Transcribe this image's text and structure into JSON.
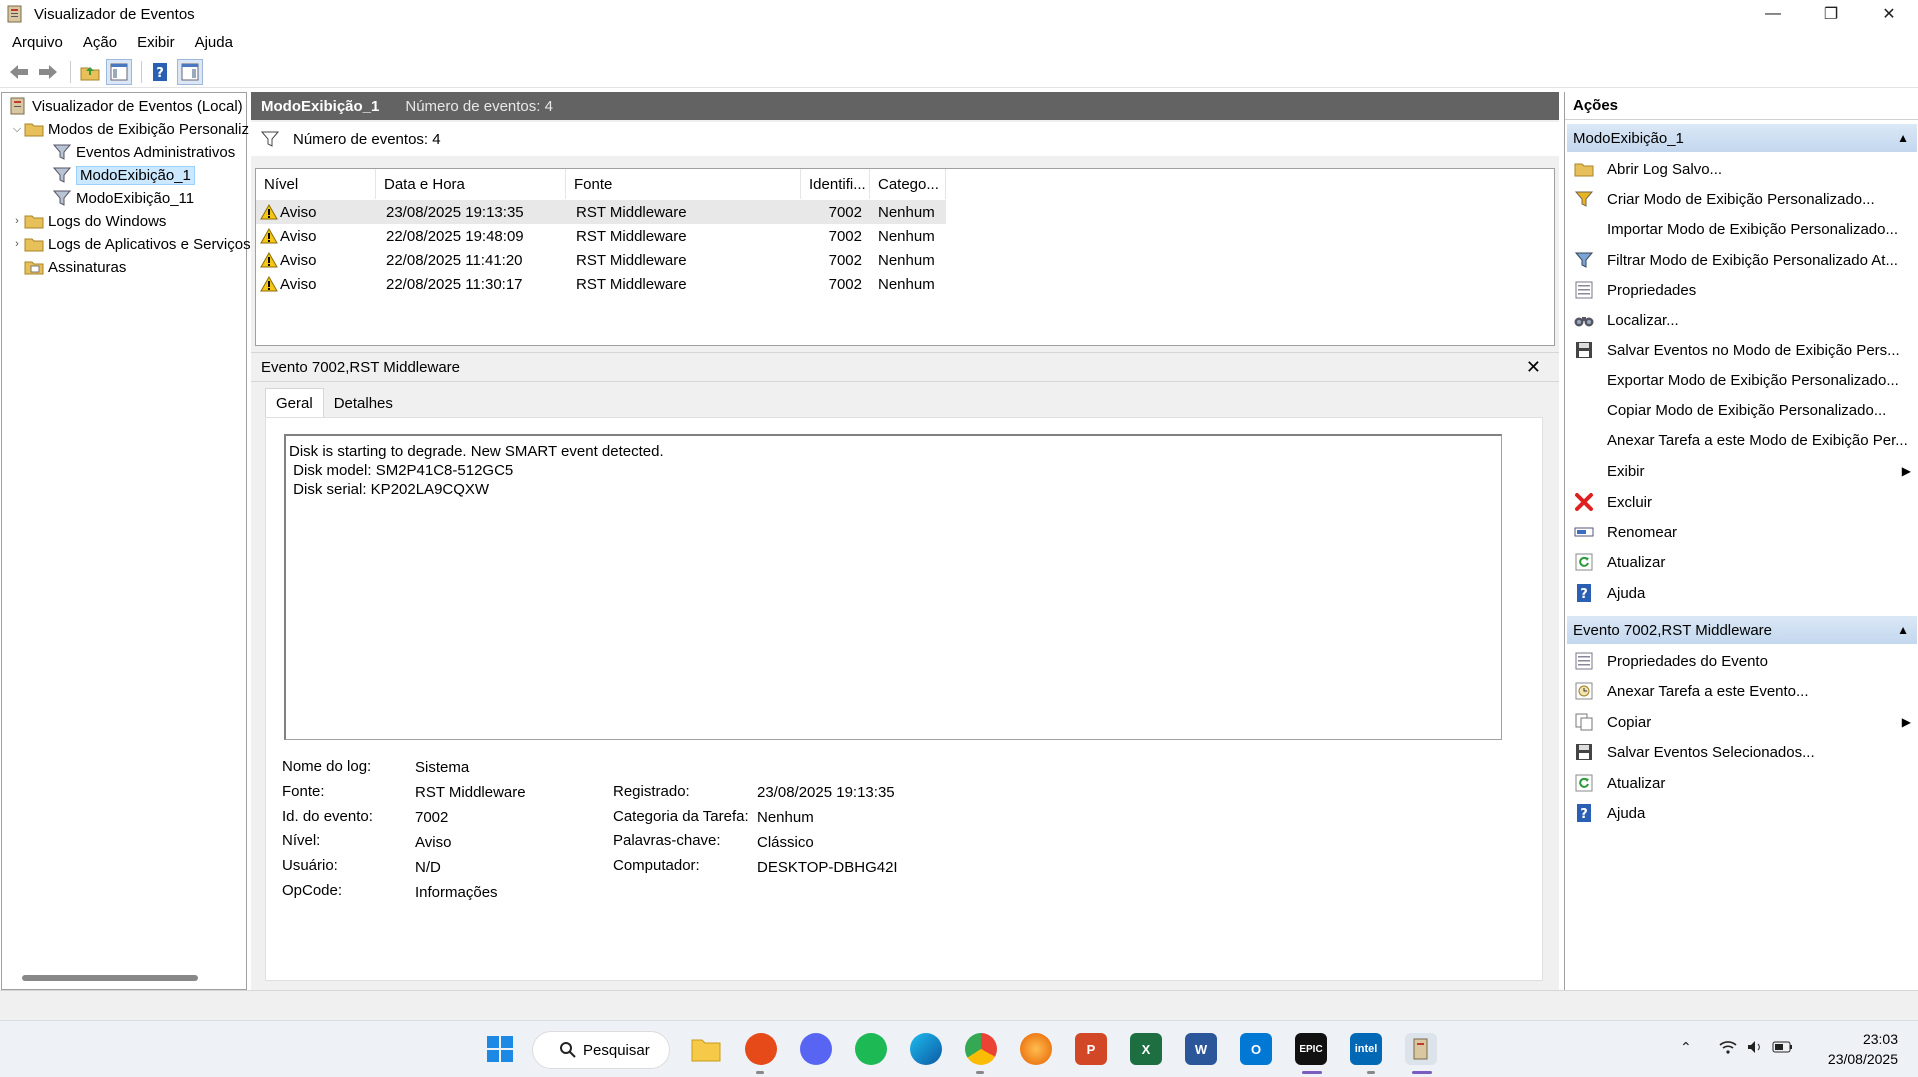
{
  "window": {
    "title": "Visualizador de Eventos",
    "controls": [
      "—",
      "❐",
      "✕"
    ]
  },
  "menu": [
    "Arquivo",
    "Ação",
    "Exibir",
    "Ajuda"
  ],
  "tree": {
    "root": "Visualizador de Eventos (Local)",
    "custom_views": "Modos de Exibição Personaliz",
    "admin_events": "Eventos Administrativos",
    "view1": "ModoExibição_1",
    "view11": "ModoExibição_11",
    "windows_logs": "Logs do Windows",
    "app_logs": "Logs de Aplicativos e Serviços",
    "subscriptions": "Assinaturas"
  },
  "center": {
    "header_name": "ModoExibição_1",
    "header_count": "Número de eventos: 4",
    "filter_text": "Número de eventos: 4",
    "columns": [
      "Nível",
      "Data e Hora",
      "Fonte",
      "Identifi...",
      "Catego..."
    ],
    "rows": [
      {
        "level": "Aviso",
        "datetime": "23/08/2025 19:13:35",
        "source": "RST Middleware",
        "id": "7002",
        "category": "Nenhum"
      },
      {
        "level": "Aviso",
        "datetime": "22/08/2025 19:48:09",
        "source": "RST Middleware",
        "id": "7002",
        "category": "Nenhum"
      },
      {
        "level": "Aviso",
        "datetime": "22/08/2025 11:41:20",
        "source": "RST Middleware",
        "id": "7002",
        "category": "Nenhum"
      },
      {
        "level": "Aviso",
        "datetime": "22/08/2025 11:30:17",
        "source": "RST Middleware",
        "id": "7002",
        "category": "Nenhum"
      }
    ]
  },
  "detail": {
    "title": "Evento 7002,RST Middleware",
    "tabs": [
      "Geral",
      "Detalhes"
    ],
    "message": "Disk is starting to degrade. New SMART event detected.\n Disk model: SM2P41C8-512GC5\n Disk serial: KP202LA9CQXW",
    "labels": {
      "log_name": "Nome do log:",
      "source": "Fonte:",
      "event_id": "Id. do evento:",
      "level": "Nível:",
      "user": "Usuário:",
      "opcode": "OpCode:",
      "logged": "Registrado:",
      "task_category": "Categoria da Tarefa:",
      "keywords": "Palavras-chave:",
      "computer": "Computador:"
    },
    "values": {
      "log_name": "Sistema",
      "source": "RST Middleware",
      "event_id": "7002",
      "level": "Aviso",
      "user": "N/D",
      "opcode": "Informações",
      "logged": "23/08/2025 19:13:35",
      "task_category": "Nenhum",
      "keywords": "Clássico",
      "computer": "DESKTOP-DBHG42I"
    }
  },
  "actions": {
    "title": "Ações",
    "section1": "ModoExibição_1",
    "items1": [
      "Abrir Log Salvo...",
      "Criar Modo de Exibição Personalizado...",
      "Importar Modo de Exibição Personalizado...",
      "Filtrar Modo de Exibição Personalizado At...",
      "Propriedades",
      "Localizar...",
      "Salvar Eventos no Modo de Exibição Pers...",
      "Exportar Modo de Exibição Personalizado...",
      "Copiar Modo de Exibição Personalizado...",
      "Anexar Tarefa a este Modo de Exibição Per...",
      "Exibir",
      "Excluir",
      "Renomear",
      "Atualizar",
      "Ajuda"
    ],
    "section2": "Evento 7002,RST Middleware",
    "items2": [
      "Propriedades do Evento",
      "Anexar Tarefa a este Evento...",
      "Copiar",
      "Salvar Eventos Selecionados...",
      "Atualizar",
      "Ajuda"
    ]
  },
  "taskbar": {
    "search": "Pesquisar",
    "time": "23:03",
    "date": "23/08/2025",
    "epic_label": "EPIC",
    "intel_label": "intel"
  },
  "colors": {
    "header": "#636363",
    "section": "#c9dbf0",
    "selection": "#cce8ff"
  }
}
